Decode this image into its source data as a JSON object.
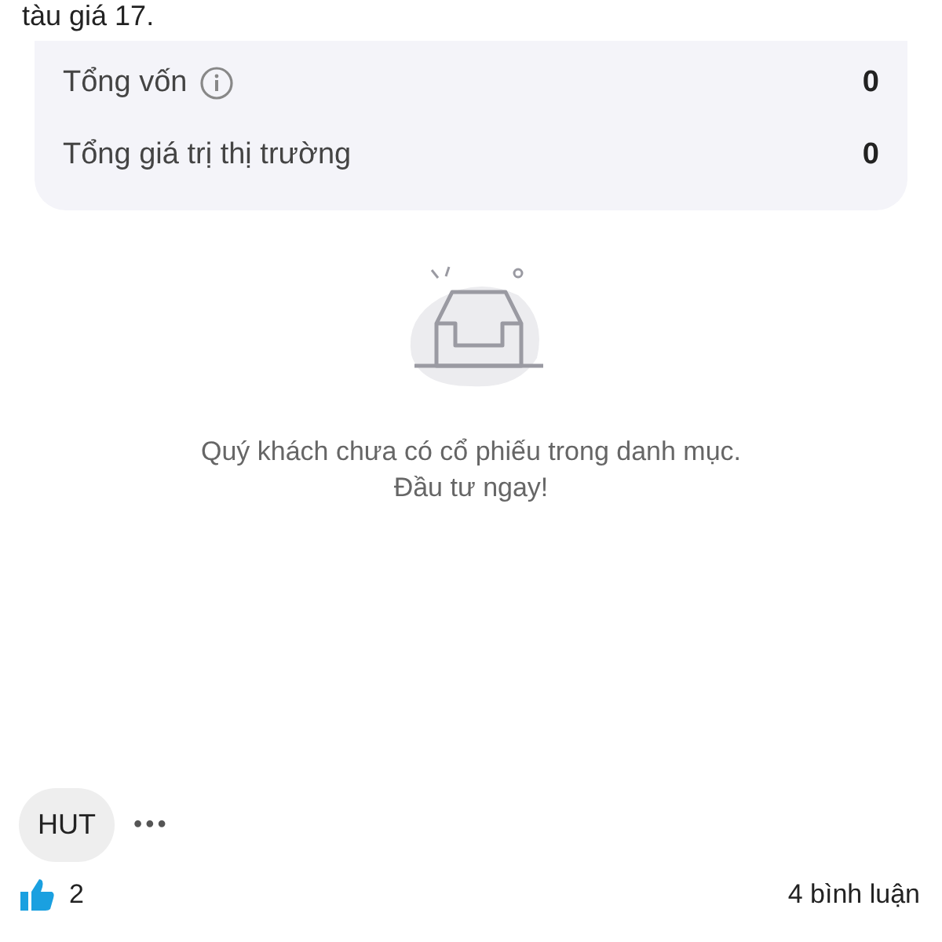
{
  "post_text": "tàu giá 17.",
  "summary": {
    "rows": [
      {
        "label": "Tổng vốn",
        "info": true,
        "value": "0"
      },
      {
        "label": "Tổng giá trị thị trường",
        "info": false,
        "value": "0"
      }
    ]
  },
  "empty_state": {
    "message": "Quý khách chưa có cổ phiếu trong danh mục.",
    "action": "Đầu tư ngay!"
  },
  "tags": [
    {
      "label": "HUT"
    }
  ],
  "more": "•••",
  "footer": {
    "likes": "2",
    "comments": "4 bình luận"
  }
}
